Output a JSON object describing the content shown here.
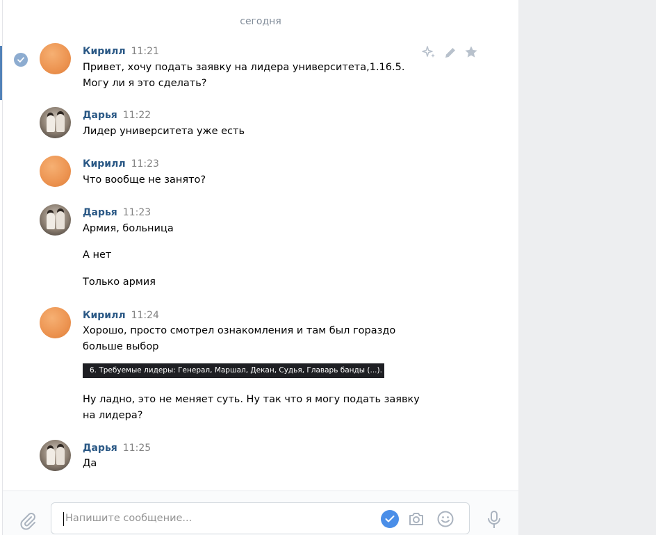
{
  "chat": {
    "date_separator": "сегодня",
    "messages": [
      {
        "author": "Кирилл",
        "time": "11:21",
        "avatar": "orange",
        "lines": [
          "Привет, хочу подать заявку на лидера университета,1.16.5.",
          "Могу ли я это сделать?"
        ]
      },
      {
        "author": "Дарья",
        "time": "11:22",
        "avatar": "photo",
        "lines": [
          "Лидер университета уже есть"
        ]
      },
      {
        "author": "Кирилл",
        "time": "11:23",
        "avatar": "orange",
        "lines": [
          "Что вообще не занято?"
        ]
      },
      {
        "author": "Дарья",
        "time": "11:23",
        "avatar": "photo",
        "lines": [
          "Армия, больница",
          "А нет",
          "Только армия"
        ]
      },
      {
        "author": "Кирилл",
        "time": "11:24",
        "avatar": "orange",
        "lines": [
          "Хорошо, просто смотрел ознакомления и там был гораздо",
          "больше выбор"
        ],
        "image_text": "6. Требуемые лидеры: Генерал, Маршал, Декан, Судья, Главарь банды (...).",
        "after_image": [
          "Ну ладно, это не меняет суть. Ну так что я могу подать заявку",
          "на лидера?"
        ]
      },
      {
        "author": "Дарья",
        "time": "11:25",
        "avatar": "photo",
        "lines": [
          "Да"
        ]
      }
    ]
  },
  "message_actions": {
    "icons": [
      "sparkle-icon",
      "pencil-icon",
      "star-icon"
    ]
  },
  "composer": {
    "placeholder": "Напишите сообщение..."
  },
  "colors": {
    "author": "#2a5885",
    "time": "#828282",
    "accent": "#4a8ee8"
  }
}
